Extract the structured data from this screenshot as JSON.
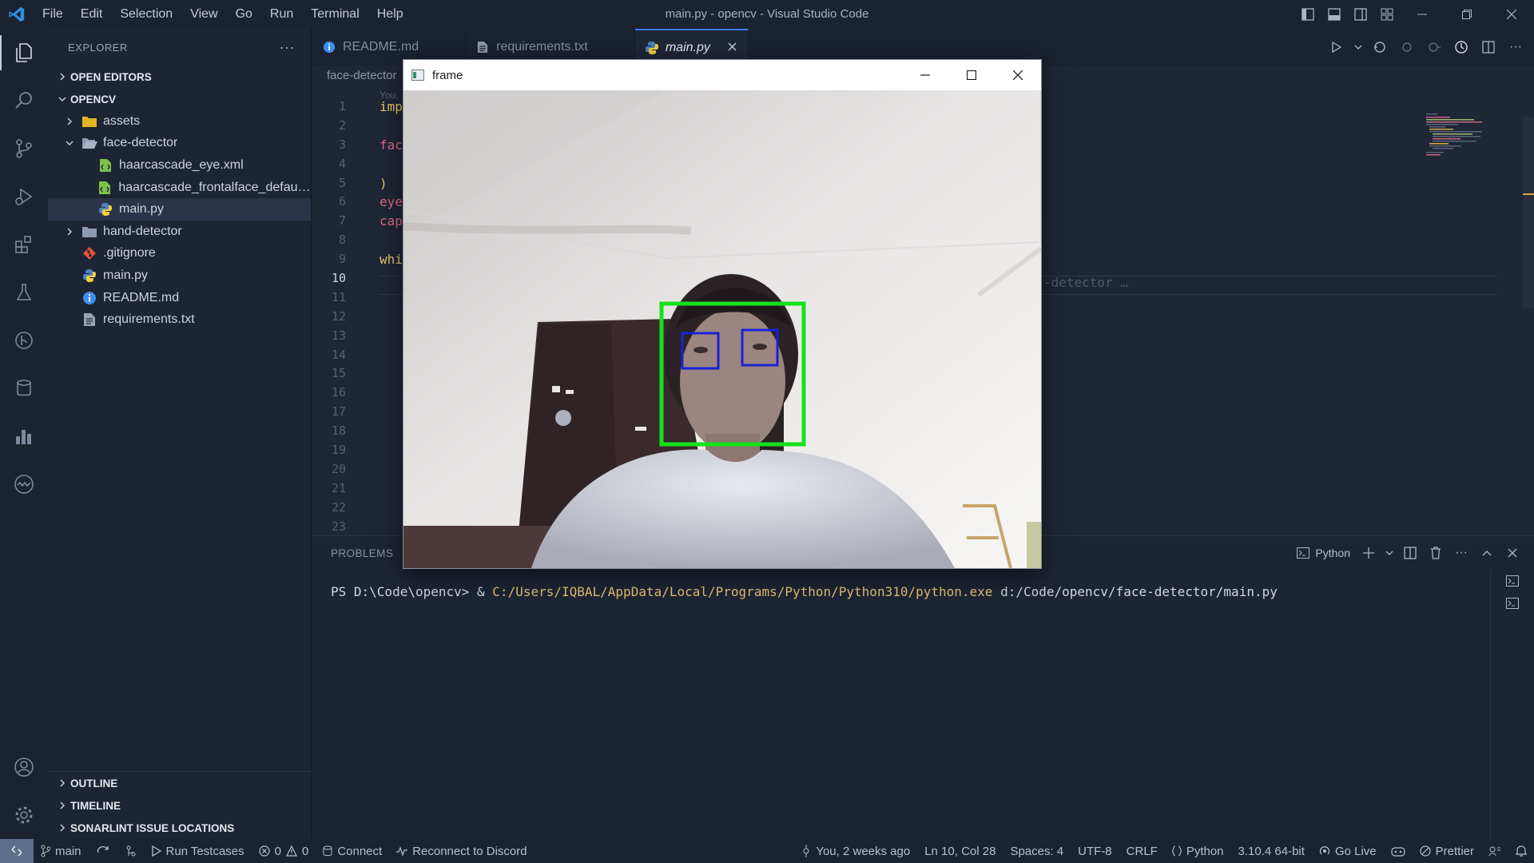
{
  "window": {
    "title": "main.py - opencv - Visual Studio Code",
    "menu": [
      "File",
      "Edit",
      "Selection",
      "View",
      "Go",
      "Run",
      "Terminal",
      "Help"
    ]
  },
  "activity_bar": {
    "top_icons": [
      "explorer-icon",
      "search-icon",
      "source-control-icon",
      "run-debug-icon",
      "extensions-icon",
      "testing-icon",
      "git-graph-icon",
      "database-icon",
      "chart-icon",
      "live-share-icon"
    ],
    "bottom_icons": [
      "account-icon",
      "settings-gear-icon"
    ]
  },
  "sidebar": {
    "title": "EXPLORER",
    "open_editors": "OPEN EDITORS",
    "root": "OPENCV",
    "tree": [
      {
        "label": "assets",
        "type": "folder",
        "depth": 1,
        "expanded": false
      },
      {
        "label": "face-detector",
        "type": "folder",
        "depth": 1,
        "expanded": true
      },
      {
        "label": "haarcascade_eye.xml",
        "type": "xml",
        "depth": 2
      },
      {
        "label": "haarcascade_frontalface_default....",
        "type": "xml",
        "depth": 2
      },
      {
        "label": "main.py",
        "type": "python",
        "depth": 2,
        "selected": true
      },
      {
        "label": "hand-detector",
        "type": "folder",
        "depth": 1,
        "expanded": false
      },
      {
        "label": ".gitignore",
        "type": "git",
        "depth": 1
      },
      {
        "label": "main.py",
        "type": "python",
        "depth": 1
      },
      {
        "label": "README.md",
        "type": "info",
        "depth": 1
      },
      {
        "label": "requirements.txt",
        "type": "text",
        "depth": 1
      }
    ],
    "bottom_sections": [
      "OUTLINE",
      "TIMELINE",
      "SONARLINT ISSUE LOCATIONS"
    ]
  },
  "editor": {
    "tabs": [
      {
        "label": "README.md",
        "icon": "info-icon",
        "active": false
      },
      {
        "label": "requirements.txt",
        "icon": "text-file-icon",
        "active": false
      },
      {
        "label": "main.py",
        "icon": "python-icon",
        "active": true
      }
    ],
    "breadcrumb": "face-detector",
    "codelens": "You,",
    "line_numbers": [
      "1",
      "2",
      "3",
      "4",
      "5",
      "6",
      "7",
      "8",
      "9",
      "10",
      "11",
      "12",
      "13",
      "14",
      "15",
      "16",
      "17",
      "18",
      "19",
      "20",
      "21",
      "22",
      "23"
    ],
    "current_line": "10",
    "code_lines": [
      {
        "text": "imp",
        "color": "#e8c86a"
      },
      {
        "text": "",
        "color": "#cdd3de"
      },
      {
        "text": "fac",
        "color": "#e06c8a"
      },
      {
        "text": "",
        "color": "#cdd3de"
      },
      {
        "text": ")",
        "color": "#e8c86a"
      },
      {
        "text": "eye",
        "color": "#e06c8a"
      },
      {
        "text": "cap",
        "color": "#e06c8a"
      },
      {
        "text": "",
        "color": "#cdd3de"
      },
      {
        "text": "whi",
        "color": "#e8c86a"
      }
    ],
    "blame": "-detector …"
  },
  "panel": {
    "tab": "PROBLEMS",
    "shell_label": "Python",
    "prompt": "PS D:\\Code\\opencv> & ",
    "exe_path": "C:/Users/IQBAL/AppData/Local/Programs/Python/Python310/python.exe",
    "arg": " d:/Code/opencv/face-detector/main.py"
  },
  "statusbar": {
    "branch": "main",
    "run_testcases": "Run Testcases",
    "errors": "0",
    "warnings": "0",
    "connect": "Connect",
    "discord": "Reconnect to Discord",
    "blame": "You, 2 weeks ago",
    "position": "Ln 10, Col 28",
    "spaces": "Spaces: 4",
    "encoding": "UTF-8",
    "eol": "CRLF",
    "language": "Python",
    "interpreter": "3.10.4 64-bit",
    "go_live": "Go Live",
    "prettier": "Prettier"
  },
  "cv_window": {
    "title": "frame",
    "face_box_color": "#16e21a",
    "eye_box_color": "#1a22d6"
  },
  "colors": {
    "accent": "#3c7df0",
    "background": "#1b2230",
    "editor": "#1f2636"
  }
}
